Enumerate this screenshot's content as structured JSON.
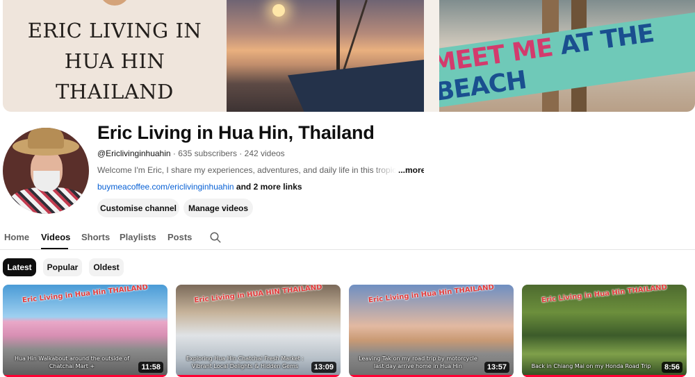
{
  "banner": {
    "title": "ERIC LIVING IN HUA HIN THAILAND",
    "sign_text_left": "MEET ME",
    "sign_text_right": "AT THE BEACH"
  },
  "channel": {
    "name": "Eric Living in Hua Hin, Thailand",
    "handle": "@Ericlivinginhuahin",
    "subscribers": "635 subscribers",
    "videos_count": "242 videos",
    "separator": " · ",
    "description": "Welcome  I'm Eric, I share my experiences, adventures, and daily life in this tropical paradise",
    "more_label": "...more",
    "link": "buymeacoffee.com/ericlivinginhuahin",
    "more_links": " and 2 more links"
  },
  "actions": {
    "customise": "Customise channel",
    "manage": "Manage videos"
  },
  "tabs": [
    {
      "label": "Home"
    },
    {
      "label": "Videos"
    },
    {
      "label": "Shorts"
    },
    {
      "label": "Playlists"
    },
    {
      "label": "Posts"
    }
  ],
  "active_tab": "Videos",
  "search_icon": "search-icon",
  "filters": [
    {
      "label": "Latest"
    },
    {
      "label": "Popular"
    },
    {
      "label": "Oldest"
    }
  ],
  "active_filter": "Latest",
  "videos": [
    {
      "overlay": "Eric Living in Hua Hin THAILAND",
      "caption": "Hua Hin Walkabout around the outside of Chatchai Mart +",
      "duration": "11:58"
    },
    {
      "overlay": "Eric Living in HUA HIN THAILAND",
      "caption": "Exploring Hua Hin Chatchai Fresh Market : Vibrant Local Delights & Hidden Gems",
      "duration": "13:09"
    },
    {
      "overlay": "Eric Living in Hua Hin THAILAND",
      "caption": "Leaving Tak on my road trip by motorcycle last day arrive home in Hua Hin",
      "duration": "13:57"
    },
    {
      "overlay": "Eric Living in Hua Hin THAILAND",
      "caption": "Back in Chiang Mai on my Honda Road Trip",
      "duration": "8:56"
    }
  ],
  "colors": {
    "link": "#065fd4",
    "chip_active_bg": "#0f0f0f",
    "progress": "#ff0033"
  }
}
